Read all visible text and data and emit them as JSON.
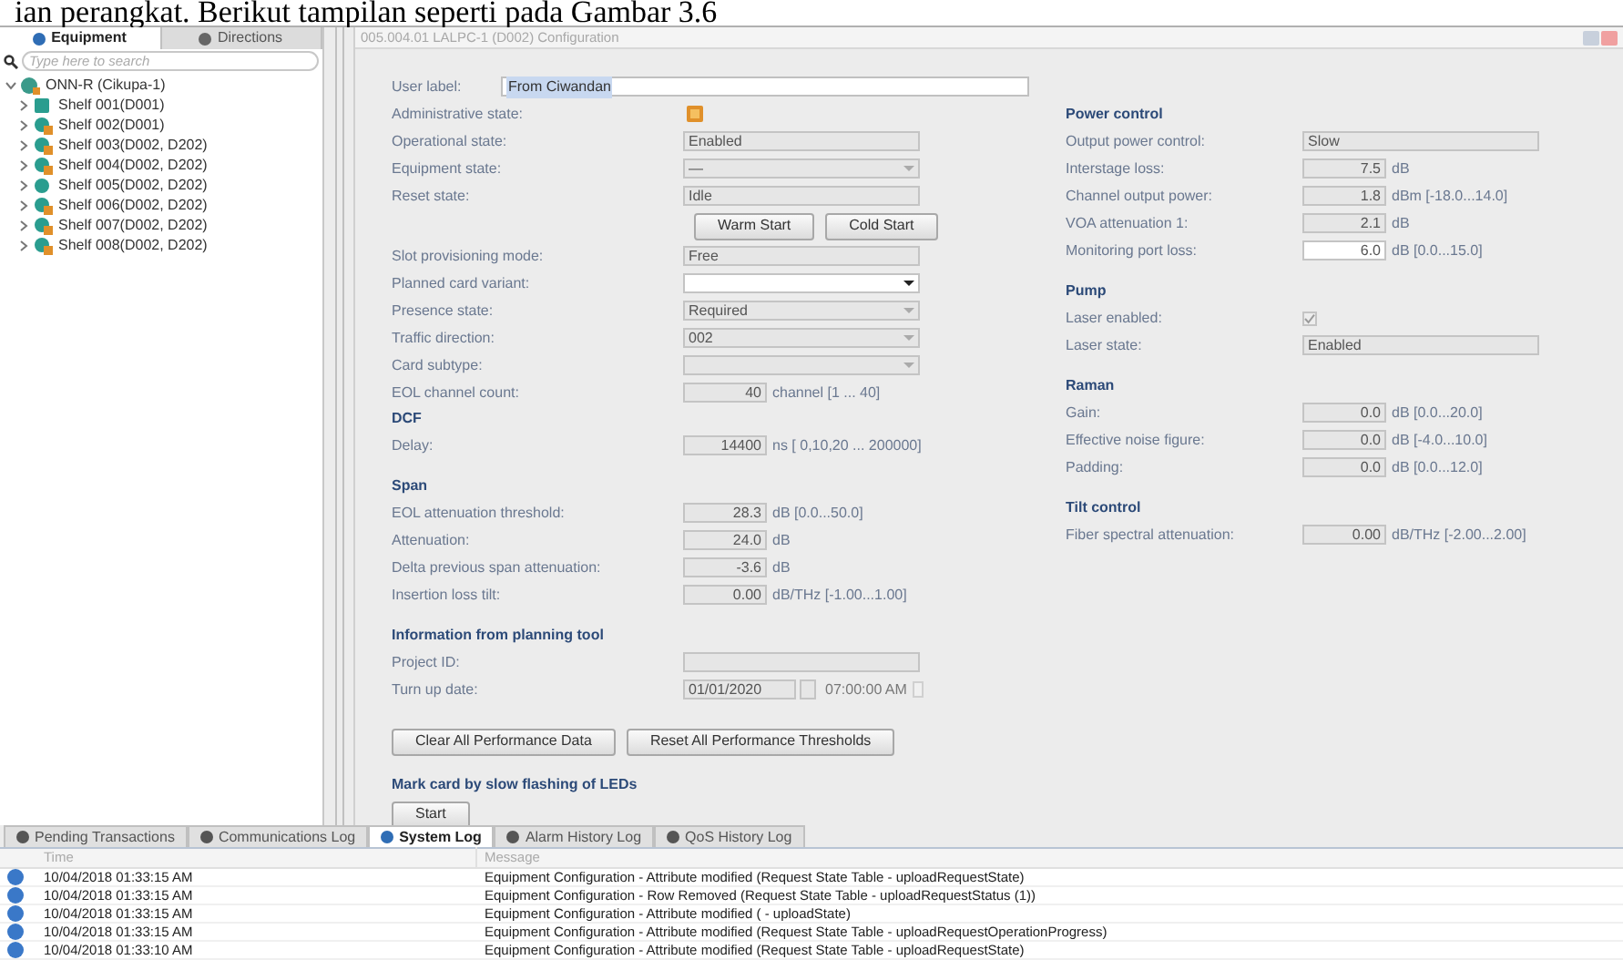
{
  "caption": "ian perangkat. Berikut tampilan seperti pada Gambar 3.6",
  "navigator": {
    "tabs": [
      {
        "label": "Equipment",
        "selected": true
      },
      {
        "label": "Directions",
        "selected": false
      }
    ],
    "search": {
      "placeholder": "Type here to search"
    },
    "tree": [
      {
        "label": "ONN-R (Cikupa-1)",
        "kind": "node",
        "expanded": true,
        "children": [
          {
            "label": "Shelf 001(D001)",
            "kind": "card",
            "expanded": false
          },
          {
            "label": "Shelf 002(D001)",
            "kind": "alarm",
            "expanded": false
          },
          {
            "label": "Shelf 003(D002, D202)",
            "kind": "alarm",
            "expanded": false
          },
          {
            "label": "Shelf 004(D002, D202)",
            "kind": "alarm",
            "expanded": false
          },
          {
            "label": "Shelf 005(D002, D202)",
            "kind": "plain",
            "expanded": false
          },
          {
            "label": "Shelf 006(D002, D202)",
            "kind": "alarm",
            "expanded": false
          },
          {
            "label": "Shelf 007(D002, D202)",
            "kind": "alarm",
            "expanded": false
          },
          {
            "label": "Shelf 008(D002, D202)",
            "kind": "alarm",
            "expanded": false
          }
        ]
      }
    ]
  },
  "config": {
    "title": "005.004.01 LALPC-1 (D002) Configuration",
    "left": [
      {
        "kind": "text_input",
        "label": "User label:",
        "value": "From Ciwandan"
      },
      {
        "kind": "lock",
        "label": "Administrative state:"
      },
      {
        "kind": "readonly",
        "label": "Operational state:",
        "value": "Enabled"
      },
      {
        "kind": "dropdown",
        "label": "Equipment state:",
        "value": "—",
        "disabled": true
      },
      {
        "kind": "readonly",
        "label": "Reset state:",
        "value": "Idle"
      },
      {
        "kind": "buttons",
        "buttons": [
          {
            "label": "Warm Start"
          },
          {
            "label": "Cold Start"
          }
        ]
      },
      {
        "kind": "readonly",
        "label": "Slot provisioning mode:",
        "value": "Free"
      },
      {
        "kind": "dropdown",
        "label": "Planned card variant:",
        "disabled": false
      },
      {
        "kind": "dropdown",
        "label": "Presence state:",
        "value": "Required",
        "disabled": true
      },
      {
        "kind": "dropdown",
        "label": "Traffic direction:",
        "value": "002",
        "disabled": true
      },
      {
        "kind": "dropdown",
        "label": "Card subtype:",
        "disabled": true
      },
      {
        "kind": "number",
        "label": "EOL channel count:",
        "value": "40",
        "unit": "channel [1 ... 40]",
        "disabled": true
      },
      {
        "kind": "heading",
        "label": "DCF"
      },
      {
        "kind": "number",
        "label": "Delay:",
        "value": "14400",
        "unit": "ns [ 0,10,20 ... 200000]",
        "disabled": true
      },
      {
        "kind": "section",
        "label": "Span"
      },
      {
        "kind": "number",
        "label": "EOL attenuation threshold:",
        "value": "28.3",
        "unit": "dB [0.0...50.0]",
        "disabled": true
      },
      {
        "kind": "number",
        "label": "Attenuation:",
        "value": "24.0",
        "unit": "dB",
        "disabled": true
      },
      {
        "kind": "number",
        "label": "Delta previous span attenuation:",
        "value": "-3.6",
        "unit": "dB",
        "disabled": true
      },
      {
        "kind": "number",
        "label": "Insertion loss tilt:",
        "value": "0.00",
        "unit": "dB/THz [-1.00...1.00]",
        "disabled": true
      },
      {
        "kind": "section",
        "label": "Information from planning tool"
      },
      {
        "kind": "readonly",
        "label": "Project ID:"
      },
      {
        "kind": "date",
        "label": "Turn up date:",
        "value": "01/01/2020",
        "time": "07:00:00 AM"
      },
      {
        "kind": "buttons",
        "buttons": [
          {
            "label": "Clear All Performance Data"
          },
          {
            "label": "Reset All Performance Thresholds"
          }
        ]
      },
      {
        "kind": "section",
        "label": "Mark card by slow flashing of LEDs"
      },
      {
        "kind": "buttons",
        "buttons": [
          {
            "label": "Start"
          }
        ]
      }
    ],
    "right": [
      {
        "kind": "heading",
        "label": "Power control"
      },
      {
        "kind": "readonly",
        "label": "Output power control:",
        "value": "Slow"
      },
      {
        "kind": "number",
        "label": "Interstage loss:",
        "value": "7.5",
        "unit": "dB",
        "disabled": true
      },
      {
        "kind": "number",
        "label": "Channel output power:",
        "value": "1.8",
        "unit": "dBm [-18.0...14.0]",
        "disabled": true
      },
      {
        "kind": "number",
        "label": "VOA attenuation 1:",
        "value": "2.1",
        "unit": "dB",
        "disabled": true
      },
      {
        "kind": "number",
        "label": "Monitoring port loss:",
        "value": "6.0",
        "unit": "dB [0.0...15.0]",
        "disabled": false
      },
      {
        "kind": "section",
        "label": "Pump"
      },
      {
        "kind": "checkbox",
        "label": "Laser enabled:",
        "checked": true
      },
      {
        "kind": "readonly",
        "label": "Laser state:",
        "value": "Enabled"
      },
      {
        "kind": "section",
        "label": "Raman"
      },
      {
        "kind": "number",
        "label": "Gain:",
        "value": "0.0",
        "unit": "dB [0.0...20.0]",
        "disabled": true
      },
      {
        "kind": "number",
        "label": "Effective noise figure:",
        "value": "0.0",
        "unit": "dB [-4.0...10.0]",
        "disabled": true
      },
      {
        "kind": "number",
        "label": "Padding:",
        "value": "0.0",
        "unit": "dB [0.0...12.0]",
        "disabled": true
      },
      {
        "kind": "section",
        "label": "Tilt control"
      },
      {
        "kind": "number",
        "label": "Fiber spectral attenuation:",
        "value": "0.00",
        "unit": "dB/THz [-2.00...2.00]",
        "disabled": true
      }
    ]
  },
  "log": {
    "tabs": [
      {
        "label": "Pending Transactions",
        "selected": false
      },
      {
        "label": "Communications Log",
        "selected": false
      },
      {
        "label": "System Log",
        "selected": true
      },
      {
        "label": "Alarm History Log",
        "selected": false
      },
      {
        "label": "QoS History Log",
        "selected": false
      }
    ],
    "columns": [
      "Time",
      "Message"
    ],
    "rows": [
      {
        "time": "10/04/2018 01:33:15 AM",
        "message": "Equipment Configuration - Attribute modified (Request State Table - uploadRequestState)"
      },
      {
        "time": "10/04/2018 01:33:15 AM",
        "message": "Equipment Configuration - Row Removed (Request State Table - uploadRequestStatus (1))"
      },
      {
        "time": "10/04/2018 01:33:15 AM",
        "message": "Equipment Configuration - Attribute modified ( - uploadState)"
      },
      {
        "time": "10/04/2018 01:33:15 AM",
        "message": "Equipment Configuration - Attribute modified (Request State Table - uploadRequestOperationProgress)"
      },
      {
        "time": "10/04/2018 01:33:10 AM",
        "message": "Equipment Configuration - Attribute modified (Request State Table - uploadRequestState)"
      }
    ]
  }
}
